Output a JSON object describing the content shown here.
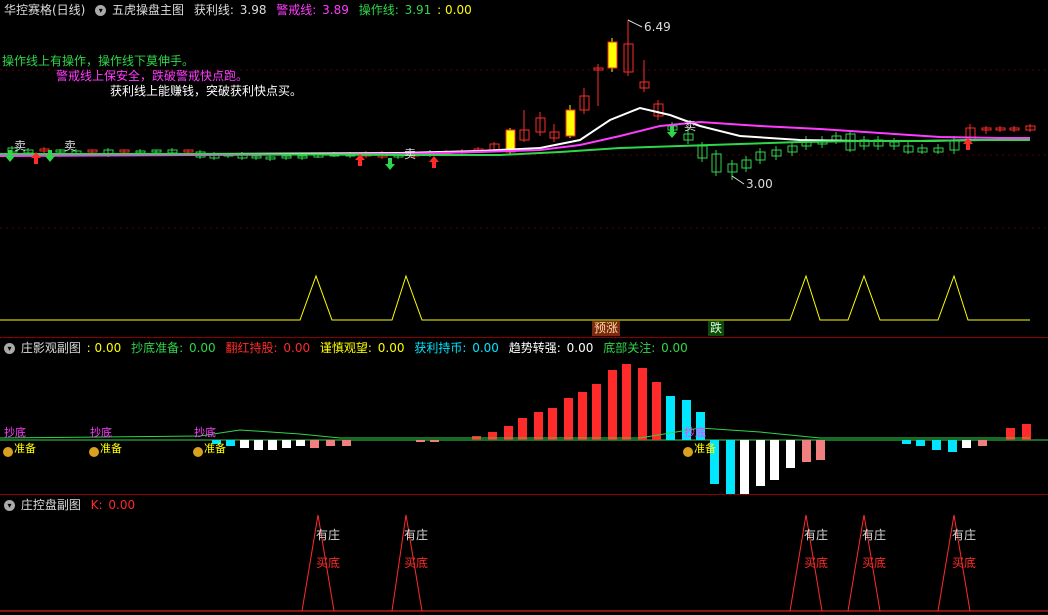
{
  "main": {
    "title": "华控赛格(日线)",
    "indicator": "五虎操盘主图",
    "profit_label": "获利线:",
    "profit_value": "3.98",
    "warn_label": "警戒线:",
    "warn_value": "3.89",
    "op_label": "操作线:",
    "op_value": "3.91",
    "extra_value": ": 0.00",
    "note1": "操作线上有操作，操作线下莫伸手。",
    "note2": "警戒线上保安全，跌破警戒快点跑。",
    "note3": "获利线上能赚钱，突破获利快点买。",
    "high_label": "6.49",
    "low_label": "3.00",
    "sell_label": "卖",
    "tag_rise": "预涨",
    "tag_fall": "跌"
  },
  "sub1": {
    "title": "庄影观副图",
    "v0": ": 0.00",
    "l1": "抄底准备:",
    "v1": "0.00",
    "l2": "翻红持股:",
    "v2": "0.00",
    "l3": "谨慎观望:",
    "v3": "0.00",
    "l4": "获利持币:",
    "v4": "0.00",
    "l5": "趋势转强:",
    "v5": "0.00",
    "l6": "底部关注:",
    "v6": "0.00",
    "bottom_label": "抄底",
    "prep_label": "准备"
  },
  "sub2": {
    "title": "庄控盘副图",
    "k_label": "K:",
    "k_value": "0.00",
    "has_label": "有庄",
    "buy_label": "买底"
  },
  "colors": {
    "bg": "#000000",
    "up": "#ff2a2a",
    "down": "#2fd64a",
    "yellow": "#ffff00",
    "magenta": "#ff3cff",
    "cyan": "#00e6ff",
    "white": "#ffffff"
  }
}
